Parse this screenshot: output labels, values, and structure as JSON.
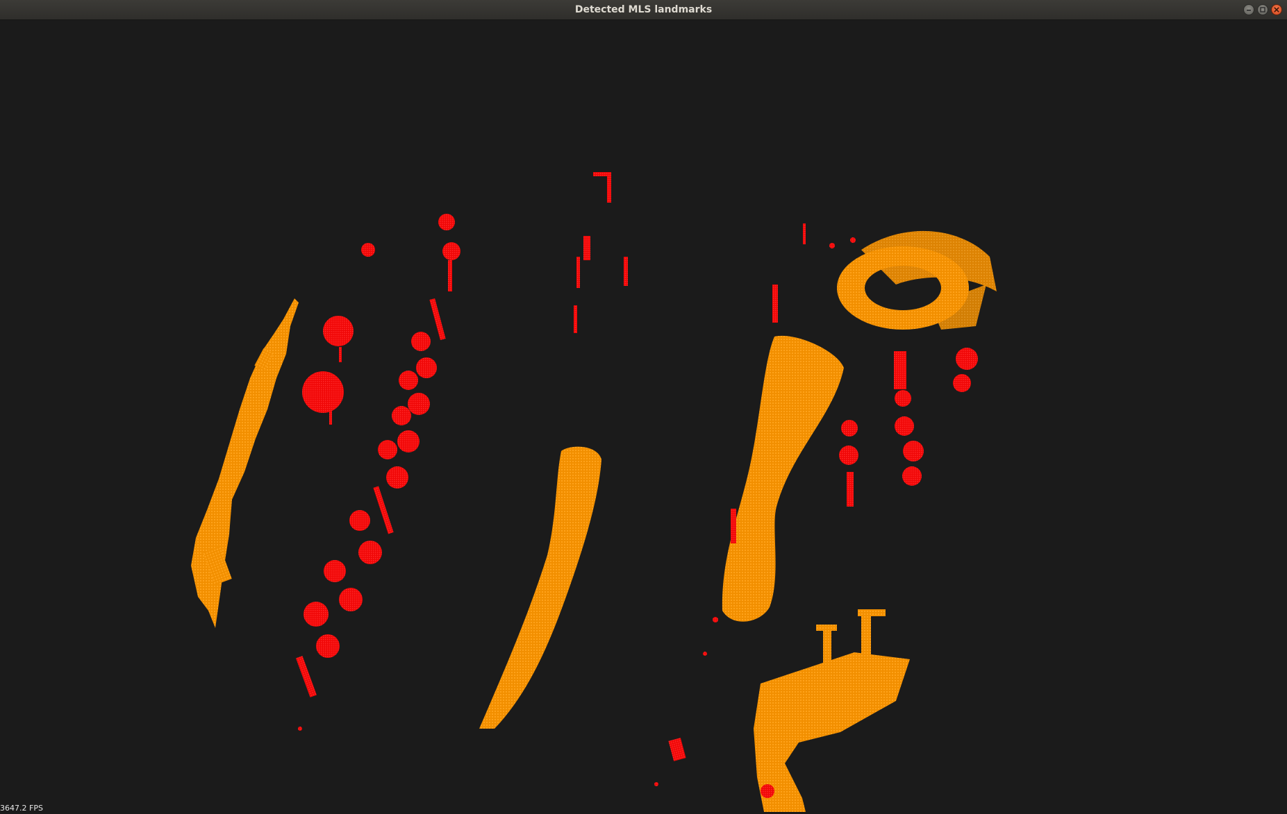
{
  "window": {
    "title": "Detected MLS landmarks",
    "controls": [
      "minimize-icon",
      "maximize-icon",
      "close-icon"
    ]
  },
  "viewer": {
    "background_color": "#1b1b1b",
    "landmark_colors": {
      "poles_and_trees": "#ff0a0a",
      "buildings_and_structures": "#ff9500"
    },
    "fps_label": "3647.2 FPS"
  }
}
